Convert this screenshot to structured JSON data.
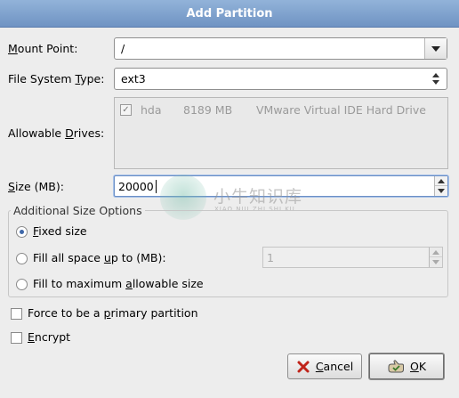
{
  "window": {
    "title": "Add Partition"
  },
  "mount_point": {
    "label_pre": "",
    "label_ul": "M",
    "label_post": "ount Point:",
    "value": "/"
  },
  "fs_type": {
    "label_pre": "File System ",
    "label_ul": "T",
    "label_post": "ype:",
    "value": "ext3"
  },
  "drives": {
    "label_pre": "Allowable ",
    "label_ul": "D",
    "label_post": "rives:",
    "rows": [
      {
        "name": "hda",
        "size": "8189 MB",
        "model": "VMware Virtual IDE Hard Drive",
        "checked": true
      }
    ]
  },
  "size": {
    "label_pre": "",
    "label_ul": "S",
    "label_post": "ize (MB):",
    "value": "20000"
  },
  "options": {
    "title": "Additional Size Options",
    "fixed": {
      "pre": "",
      "ul": "F",
      "post": "ixed size",
      "selected": true
    },
    "fill_upto": {
      "pre": "Fill all space ",
      "ul": "u",
      "post": "p to (MB):",
      "value": "1"
    },
    "fill_max": {
      "pre": "Fill to maximum ",
      "ul": "a",
      "post": "llowable size"
    }
  },
  "primary": {
    "pre": "Force to be a ",
    "ul": "p",
    "post": "rimary partition"
  },
  "encrypt": {
    "pre": "",
    "ul": "E",
    "post": "ncrypt"
  },
  "buttons": {
    "cancel": {
      "pre": "",
      "ul": "C",
      "post": "ancel",
      "icon": "cancel-x-icon"
    },
    "ok": {
      "pre": "",
      "ul": "O",
      "post": "K",
      "icon": "ok-hand-icon"
    }
  },
  "watermark": {
    "text": "小牛知识库",
    "sub": "XIAO NIU ZHI SHI KU"
  },
  "colors": {
    "title_bg": "#7fa2cf",
    "focus": "#6b8fc6",
    "radio_dot": "#3e67a8"
  }
}
